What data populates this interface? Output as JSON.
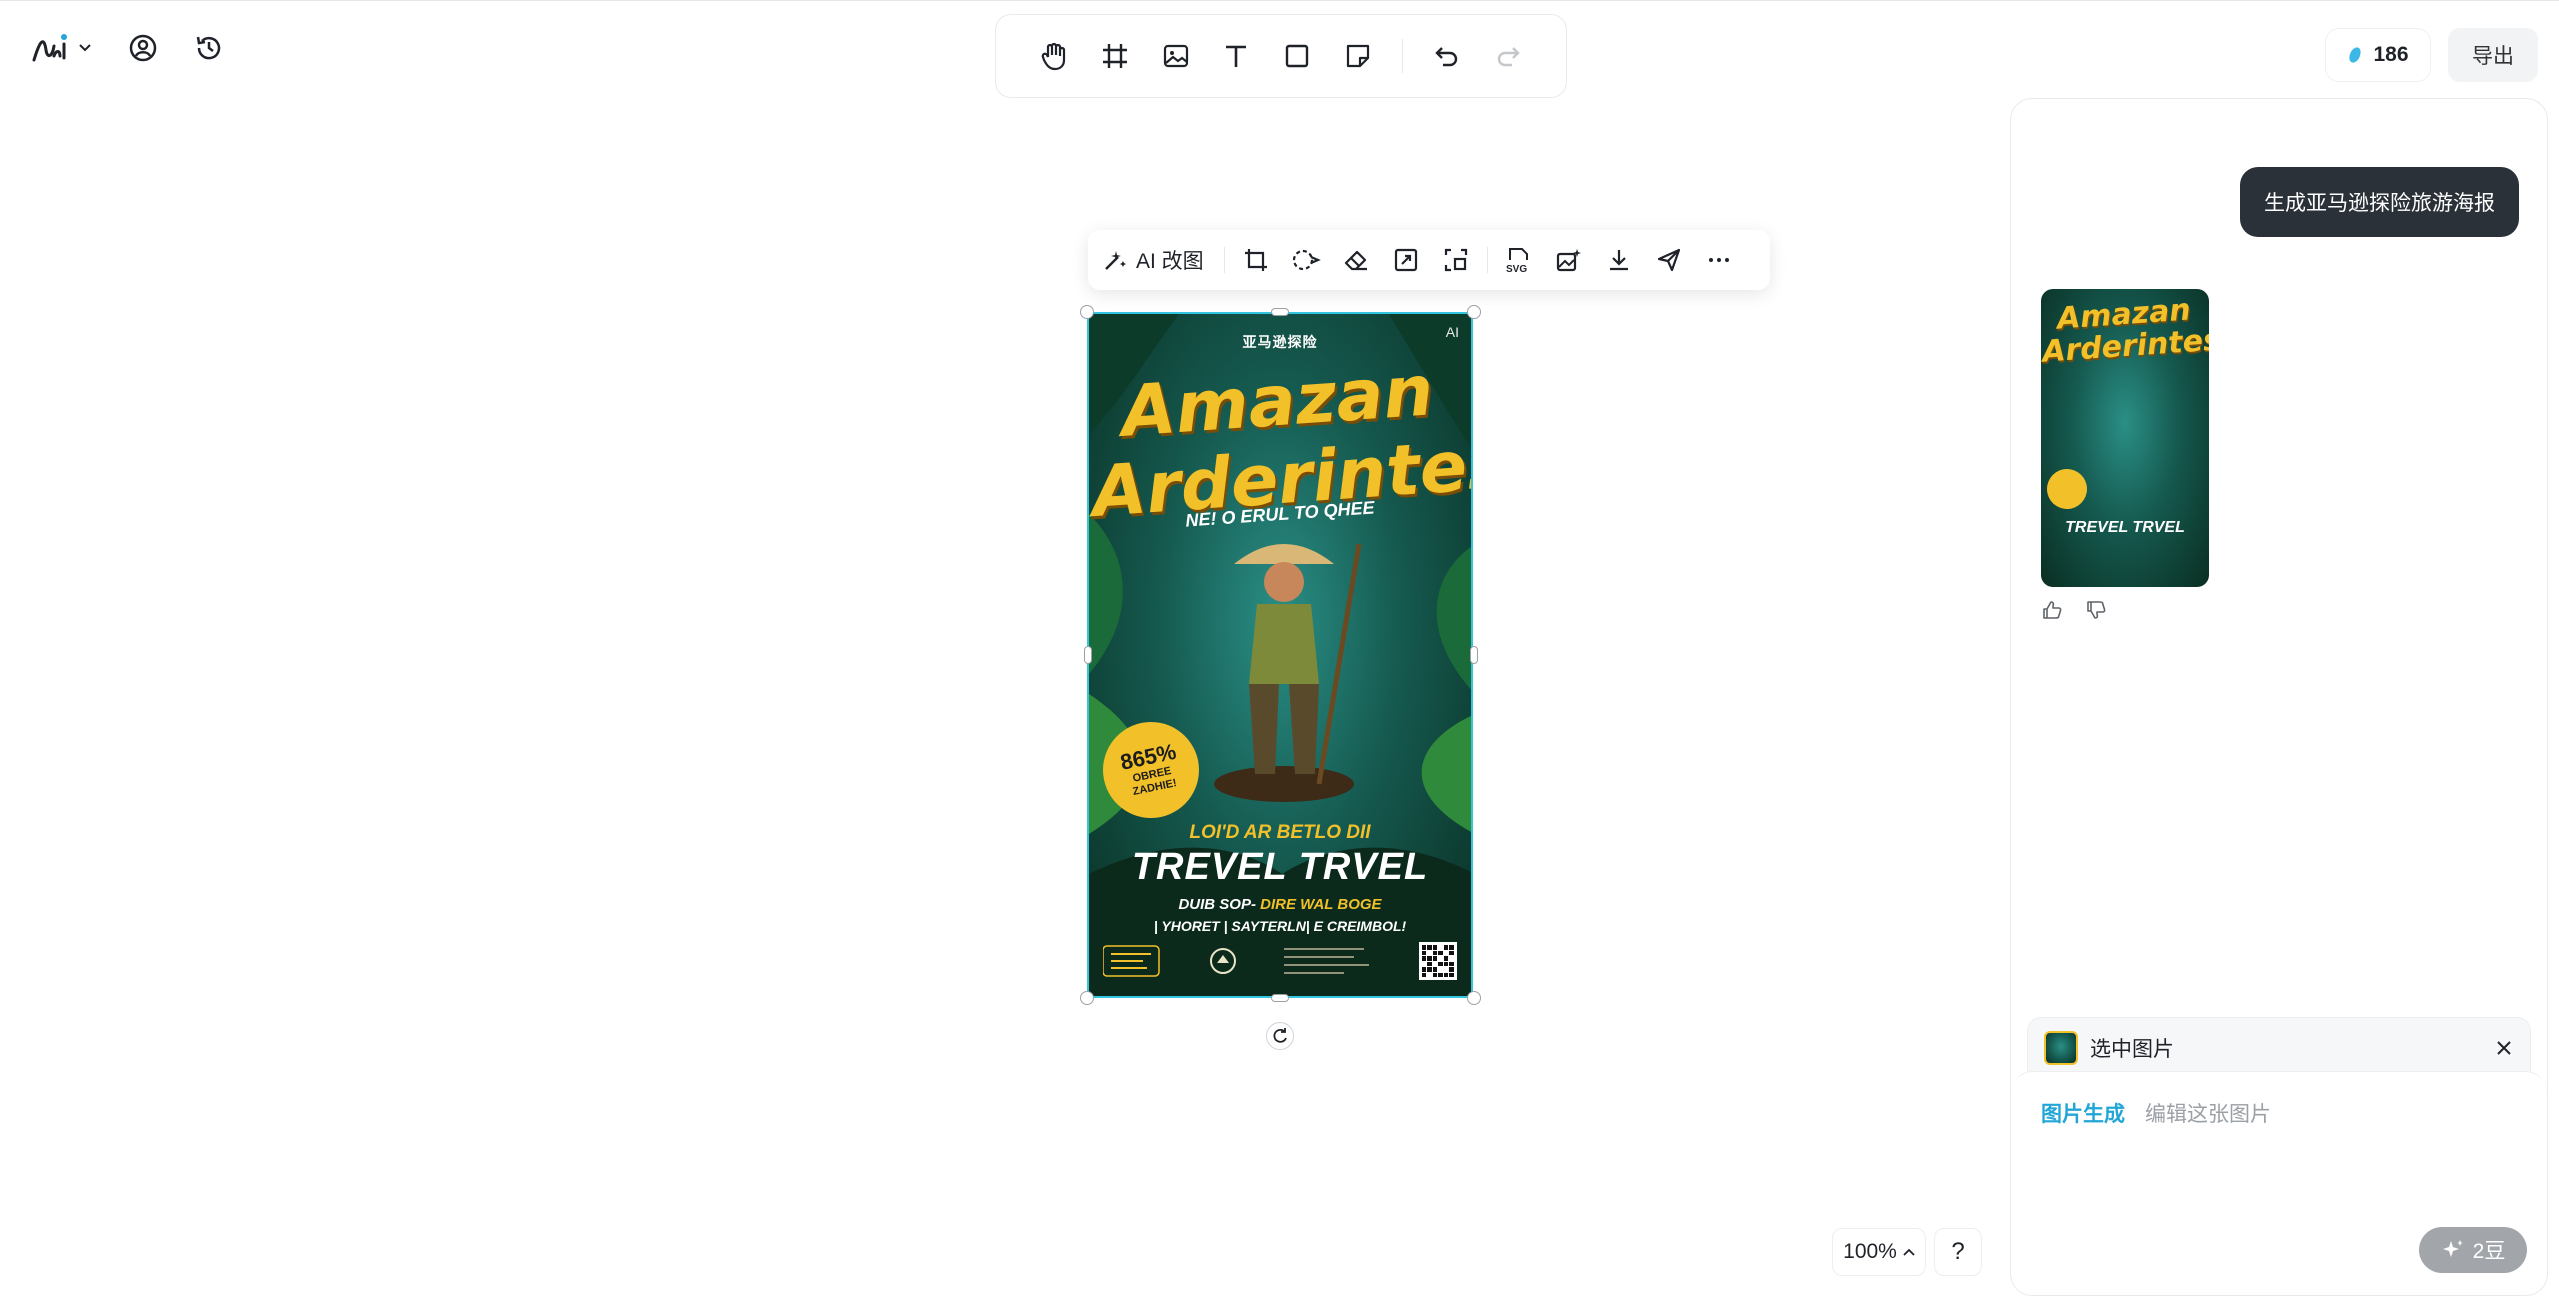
{
  "toolbar": {
    "tools": [
      "hand-icon",
      "frame-icon",
      "image-icon",
      "text-icon",
      "rectangle-icon",
      "sticky-note-icon"
    ],
    "history": [
      "undo-icon",
      "redo-icon"
    ]
  },
  "header": {
    "credits": "186",
    "export_label": "导出"
  },
  "image_toolbar": {
    "ai_edit_label": "AI 改图",
    "svg_label": "SVG"
  },
  "poster": {
    "brand": "亚马逊探险",
    "ai_tag": "AI",
    "title_line1": "Amazan",
    "title_line2": "Arderintes",
    "subtitle": "NE! O ERUL TO QHEE",
    "badge_line1": "865%",
    "badge_line2": "OBREE",
    "badge_line3": "ZADHIE!",
    "line1": "LOI'D AR BETLO DII",
    "line2": "TREVEL TRVEL",
    "line3_white": "DUIB SOP-",
    "line3_yellow": "DIRE WAL BOGE",
    "line4": "| YHORET | SAYTERLN| E CREIMBOL!"
  },
  "canvas": {
    "zoom": "100%",
    "help": "?"
  },
  "chat": {
    "user_message": "生成亚马逊探险旅游海报",
    "result_title": "Amazan Arderintes",
    "result_subtitle": "TREVEL TRVEL",
    "selected_label": "选中图片",
    "mode_active": "图片生成",
    "mode_other": "编辑这张图片",
    "generate_cost": "2豆"
  },
  "colors": {
    "accent": "#22a6d6",
    "selection": "#33c4e0",
    "poster_yellow": "#f2c029"
  }
}
